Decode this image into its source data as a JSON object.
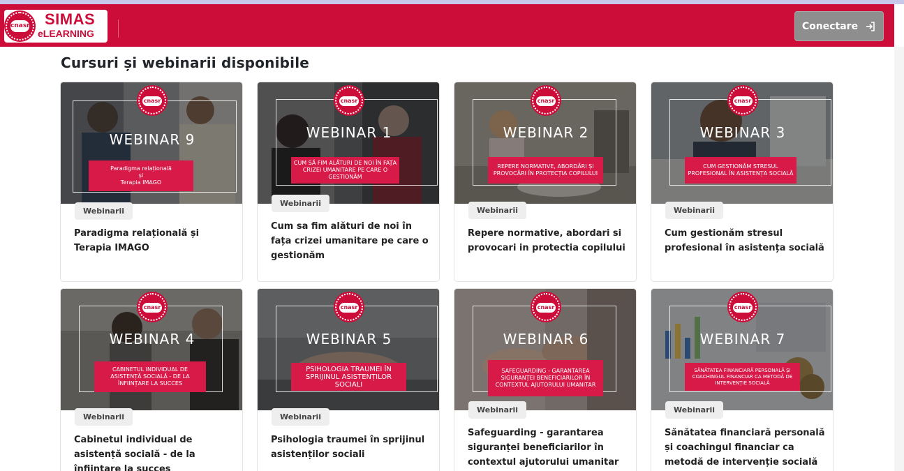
{
  "header": {
    "logo_title": "SIMAS",
    "logo_subtitle": "eLEARNING",
    "logo_seal_text": "cnasr",
    "login_label": "Conectare",
    "brand_color": "#cc0d39"
  },
  "page": {
    "title": "Cursuri și webinarii disponibile"
  },
  "courses": [
    {
      "tag": "Webinarii",
      "badge": "cnasr",
      "image_title": "WEBINAR 9",
      "image_subtitle": "Paradigma relațională\nși\nTerapia IMAGO",
      "title": "Paradigma relațională și Terapia IMAGO"
    },
    {
      "tag": "Webinarii",
      "badge": "cnasr",
      "image_title": "WEBINAR 1",
      "image_subtitle": "CUM SĂ FIM ALĂTURI DE NOI ÎN FAȚA CRIZEI UMANITARE PE CARE O GESTIONĂM",
      "title": "Cum sa fim alături de noi în fața crizei umanitare pe care o gestionăm"
    },
    {
      "tag": "Webinarii",
      "badge": "cnasr",
      "image_title": "WEBINAR 2",
      "image_subtitle": "REPERE NORMATIVE, ABORDĂRI ȘI PROVOCĂRI ÎN PROTECȚIA COPILULUI",
      "title": "Repere normative, abordari si provocari in protectia copilului"
    },
    {
      "tag": "Webinarii",
      "badge": "cnasr",
      "image_title": "WEBINAR 3",
      "image_subtitle": "CUM GESTIONĂM STRESUL PROFESIONAL ÎN ASISTENȚA SOCIALĂ",
      "title": "Cum gestionăm stresul profesional în asistența socială"
    },
    {
      "tag": "Webinarii",
      "badge": "cnasr",
      "image_title": "WEBINAR 4",
      "image_subtitle": "CABINETUL INDIVIDUAL DE ASISTENȚĂ SOCIALĂ - DE LA ÎNFIINȚARE LA SUCCES",
      "title": "Cabinetul individual de asistență socială - de la înființare la succes"
    },
    {
      "tag": "Webinarii",
      "badge": "cnasr",
      "image_title": "WEBINAR 5",
      "image_subtitle": "PSIHOLOGIA TRAUMEI ÎN SPRIJINUL ASISTENȚILOR SOCIALI",
      "title": "Psihologia traumei în sprijinul asistenților sociali"
    },
    {
      "tag": "Webinarii",
      "badge": "cnasr",
      "image_title": "WEBINAR 6",
      "image_subtitle": "SAFEGUARDING - GARANTAREA SIGURANȚEI BENEFICIARILOR ÎN CONTEXTUL AJUTORULUI UMANITAR",
      "title": "Safeguarding - garantarea siguranței beneficiarilor în contextul ajutorului umanitar"
    },
    {
      "tag": "Webinarii",
      "badge": "cnasr",
      "image_title": "WEBINAR 7",
      "image_subtitle": "SĂNĂTATEA FINANCIARĂ PERSONALĂ ȘI COACHINGUL FINANCIAR CA METODĂ DE INTERVENȚIE SOCIALĂ",
      "title": "Sănătatea financiară personală și coachingul financiar ca metodă de intervenție socială"
    }
  ]
}
